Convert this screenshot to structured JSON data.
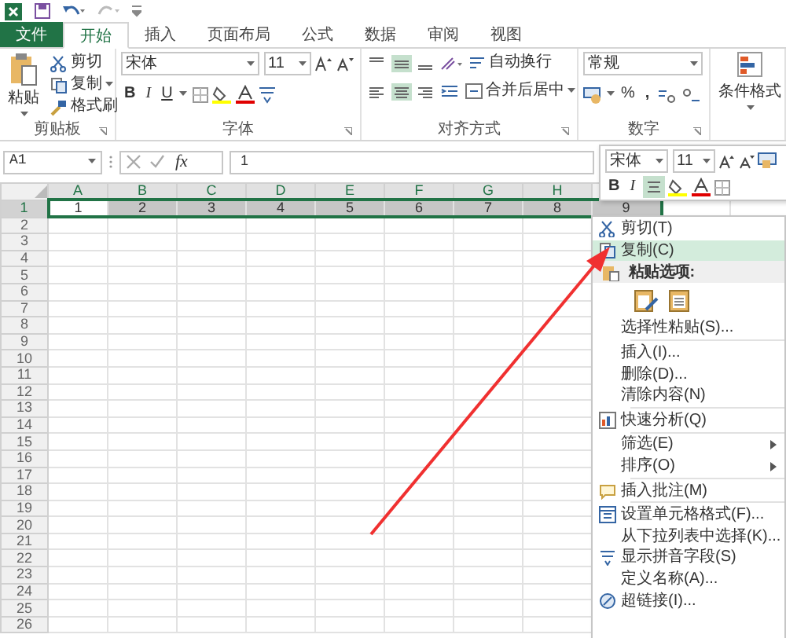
{
  "tabs": [
    {
      "label": "文件",
      "kind": "file",
      "selected": false
    },
    {
      "label": "开始",
      "kind": "tab",
      "selected": true
    },
    {
      "label": "插入",
      "kind": "tab",
      "selected": false
    },
    {
      "label": "页面布局",
      "kind": "tab",
      "selected": false
    },
    {
      "label": "公式",
      "kind": "tab",
      "selected": false
    },
    {
      "label": "数据",
      "kind": "tab",
      "selected": false
    },
    {
      "label": "审阅",
      "kind": "tab",
      "selected": false
    },
    {
      "label": "视图",
      "kind": "tab",
      "selected": false
    }
  ],
  "ribbon": {
    "clipboard": {
      "title": "剪贴板",
      "paste": "粘贴",
      "cut": "剪切",
      "copy": "复制",
      "format_painter": "格式刷"
    },
    "font": {
      "title": "字体",
      "font_name": "宋体",
      "font_size": "11",
      "bold": "B",
      "italic": "I",
      "underline": "U"
    },
    "alignment": {
      "title": "对齐方式",
      "wrap_text": "自动换行",
      "merge_center": "合并后居中",
      "middle_align_pressed": true,
      "center_pressed": true
    },
    "number": {
      "title": "数字",
      "format": "常规",
      "percent": "%",
      "comma": ","
    },
    "styles": {
      "conditional_format": "条件格式"
    }
  },
  "formula_bar": {
    "name_box": "A1",
    "fx": "fx",
    "value": "1"
  },
  "sheet": {
    "columns": [
      "A",
      "B",
      "C",
      "D",
      "E",
      "F",
      "G",
      "H"
    ],
    "rows": [
      {
        "label": "1",
        "selected": true,
        "cells": [
          {
            "text": "1",
            "active": true
          },
          {
            "text": "2",
            "active": false
          },
          {
            "text": "3",
            "active": false
          },
          {
            "text": "4",
            "active": false
          },
          {
            "text": "5",
            "active": false
          },
          {
            "text": "6",
            "active": false
          },
          {
            "text": "7",
            "active": false
          },
          {
            "text": "8",
            "active": false
          },
          {
            "text": "9",
            "active": false
          }
        ]
      },
      {
        "label": "2",
        "selected": false
      },
      {
        "label": "3",
        "selected": false
      },
      {
        "label": "4",
        "selected": false
      },
      {
        "label": "5",
        "selected": false
      },
      {
        "label": "6",
        "selected": false
      },
      {
        "label": "7",
        "selected": false
      },
      {
        "label": "8",
        "selected": false
      },
      {
        "label": "9",
        "selected": false
      },
      {
        "label": "10",
        "selected": false
      },
      {
        "label": "11",
        "selected": false
      },
      {
        "label": "12",
        "selected": false
      },
      {
        "label": "13",
        "selected": false
      },
      {
        "label": "14",
        "selected": false
      },
      {
        "label": "15",
        "selected": false
      },
      {
        "label": "16",
        "selected": false
      },
      {
        "label": "17",
        "selected": false
      },
      {
        "label": "18",
        "selected": false
      },
      {
        "label": "19",
        "selected": false
      },
      {
        "label": "20",
        "selected": false
      },
      {
        "label": "21",
        "selected": false
      },
      {
        "label": "22",
        "selected": false
      },
      {
        "label": "23",
        "selected": false
      },
      {
        "label": "24",
        "selected": false
      },
      {
        "label": "25",
        "selected": false
      },
      {
        "label": "26",
        "selected": false
      }
    ]
  },
  "mini_toolbar": {
    "font_name": "宋体",
    "font_size": "11",
    "bold": "B",
    "italic": "I",
    "center_pressed": true
  },
  "context_menu": [
    {
      "kind": "item",
      "label": "剪切(T)",
      "selected": false,
      "submenu": false
    },
    {
      "kind": "item",
      "label": "复制(C)",
      "selected": true,
      "submenu": false
    },
    {
      "kind": "header",
      "label": "粘贴选项:"
    },
    {
      "kind": "paste_icons"
    },
    {
      "kind": "item",
      "label": "选择性粘贴(S)...",
      "selected": false,
      "submenu": false
    },
    {
      "kind": "separator"
    },
    {
      "kind": "item",
      "label": "插入(I)...",
      "selected": false,
      "submenu": false
    },
    {
      "kind": "item",
      "label": "删除(D)...",
      "selected": false,
      "submenu": false
    },
    {
      "kind": "item",
      "label": "清除内容(N)",
      "selected": false,
      "submenu": false
    },
    {
      "kind": "separator"
    },
    {
      "kind": "item",
      "label": "快速分析(Q)",
      "selected": false,
      "submenu": false
    },
    {
      "kind": "separator"
    },
    {
      "kind": "item",
      "label": "筛选(E)",
      "selected": false,
      "submenu": true
    },
    {
      "kind": "item",
      "label": "排序(O)",
      "selected": false,
      "submenu": true
    },
    {
      "kind": "separator"
    },
    {
      "kind": "item",
      "label": "插入批注(M)",
      "selected": false,
      "submenu": false
    },
    {
      "kind": "separator"
    },
    {
      "kind": "item",
      "label": "设置单元格格式(F)...",
      "selected": false,
      "submenu": false
    },
    {
      "kind": "item",
      "label": "从下拉列表中选择(K)...",
      "selected": false,
      "submenu": false
    },
    {
      "kind": "item",
      "label": "显示拼音字段(S)",
      "selected": false,
      "submenu": false
    },
    {
      "kind": "item",
      "label": "定义名称(A)...",
      "selected": false,
      "submenu": false
    },
    {
      "kind": "item",
      "label": "超链接(I)...",
      "selected": false,
      "submenu": false
    }
  ]
}
